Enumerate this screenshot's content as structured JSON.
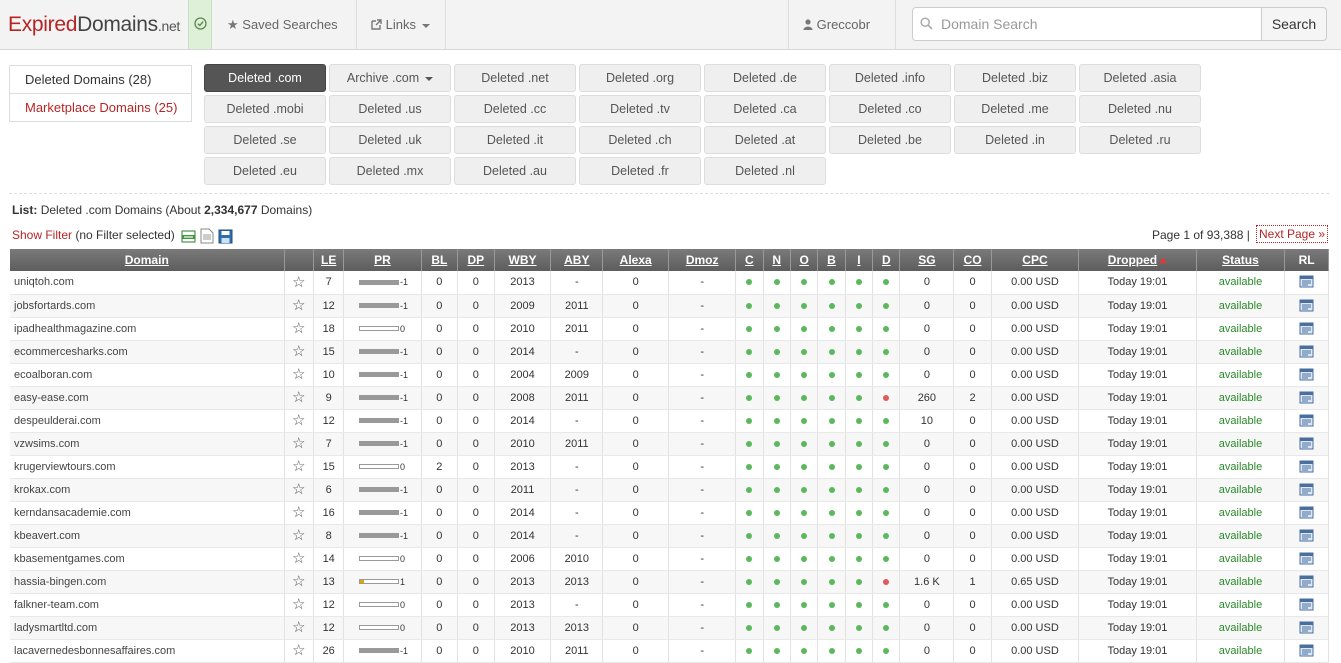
{
  "brand": {
    "part1": "Expired",
    "part2": "Domains",
    "part3": ".net"
  },
  "nav": {
    "saved_searches": "Saved Searches",
    "links": "Links",
    "user": "Greccobr",
    "search_placeholder": "Domain Search",
    "search_button": "Search"
  },
  "sidebar": {
    "items": [
      {
        "label": "Deleted Domains (28)"
      },
      {
        "label": "Marketplace Domains (25)"
      }
    ]
  },
  "tlds": [
    [
      "Deleted .com",
      "Archive .com",
      "Deleted .net",
      "Deleted .org",
      "Deleted .de",
      "Deleted .info",
      "Deleted .biz",
      "Deleted .asia"
    ],
    [
      "Deleted .mobi",
      "Deleted .us",
      "Deleted .cc",
      "Deleted .tv",
      "Deleted .ca",
      "Deleted .co",
      "Deleted .me",
      "Deleted .nu"
    ],
    [
      "Deleted .se",
      "Deleted .uk",
      "Deleted .it",
      "Deleted .ch",
      "Deleted .at",
      "Deleted .be",
      "Deleted .in",
      "Deleted .ru"
    ],
    [
      "Deleted .eu",
      "Deleted .mx",
      "Deleted .au",
      "Deleted .fr",
      "Deleted .nl"
    ]
  ],
  "list": {
    "label": "List:",
    "text": "Deleted .com Domains (About",
    "count": "2,334,677",
    "suffix": "Domains)"
  },
  "filter": {
    "link": "Show Filter",
    "state": "(no Filter selected)"
  },
  "pagination": {
    "info": "Page 1 of 93,388",
    "separator": "|",
    "next": "Next Page »"
  },
  "table": {
    "headers": [
      "Domain",
      "",
      "LE",
      "PR",
      "BL",
      "DP",
      "WBY",
      "ABY",
      "Alexa",
      "Dmoz",
      "C",
      "N",
      "O",
      "B",
      "I",
      "D",
      "SG",
      "CO",
      "CPC",
      "Dropped",
      "Status",
      "RL"
    ],
    "rows": [
      {
        "domain": "uniqtoh.com",
        "le": "7",
        "pr": "-1",
        "bl": "0",
        "dp": "0",
        "wby": "2013",
        "aby": "-",
        "alexa": "0",
        "dmoz": "-",
        "d": "green",
        "sg": "0",
        "co": "0",
        "cpc": "0.00 USD",
        "dropped": "Today 19:01",
        "status": "available"
      },
      {
        "domain": "jobsfortards.com",
        "le": "12",
        "pr": "-1",
        "bl": "0",
        "dp": "0",
        "wby": "2009",
        "aby": "2011",
        "alexa": "0",
        "dmoz": "-",
        "d": "green",
        "sg": "0",
        "co": "0",
        "cpc": "0.00 USD",
        "dropped": "Today 19:01",
        "status": "available"
      },
      {
        "domain": "ipadhealthmagazine.com",
        "le": "18",
        "pr": "0",
        "bl": "0",
        "dp": "0",
        "wby": "2010",
        "aby": "2011",
        "alexa": "0",
        "dmoz": "-",
        "d": "green",
        "sg": "0",
        "co": "0",
        "cpc": "0.00 USD",
        "dropped": "Today 19:01",
        "status": "available"
      },
      {
        "domain": "ecommercesharks.com",
        "le": "15",
        "pr": "-1",
        "bl": "0",
        "dp": "0",
        "wby": "2014",
        "aby": "-",
        "alexa": "0",
        "dmoz": "-",
        "d": "green",
        "sg": "0",
        "co": "0",
        "cpc": "0.00 USD",
        "dropped": "Today 19:01",
        "status": "available"
      },
      {
        "domain": "ecoalboran.com",
        "le": "10",
        "pr": "-1",
        "bl": "0",
        "dp": "0",
        "wby": "2004",
        "aby": "2009",
        "alexa": "0",
        "dmoz": "-",
        "d": "green",
        "sg": "0",
        "co": "0",
        "cpc": "0.00 USD",
        "dropped": "Today 19:01",
        "status": "available"
      },
      {
        "domain": "easy-ease.com",
        "le": "9",
        "pr": "-1",
        "bl": "0",
        "dp": "0",
        "wby": "2008",
        "aby": "2011",
        "alexa": "0",
        "dmoz": "-",
        "d": "red",
        "sg": "260",
        "co": "2",
        "cpc": "0.00 USD",
        "dropped": "Today 19:01",
        "status": "available"
      },
      {
        "domain": "despeulderai.com",
        "le": "12",
        "pr": "-1",
        "bl": "0",
        "dp": "0",
        "wby": "2014",
        "aby": "-",
        "alexa": "0",
        "dmoz": "-",
        "d": "green",
        "sg": "10",
        "co": "0",
        "cpc": "0.00 USD",
        "dropped": "Today 19:01",
        "status": "available"
      },
      {
        "domain": "vzwsims.com",
        "le": "7",
        "pr": "-1",
        "bl": "0",
        "dp": "0",
        "wby": "2010",
        "aby": "2011",
        "alexa": "0",
        "dmoz": "-",
        "d": "green",
        "sg": "0",
        "co": "0",
        "cpc": "0.00 USD",
        "dropped": "Today 19:01",
        "status": "available"
      },
      {
        "domain": "krugerviewtours.com",
        "le": "15",
        "pr": "0",
        "bl": "2",
        "dp": "0",
        "wby": "2013",
        "aby": "-",
        "alexa": "0",
        "dmoz": "-",
        "d": "green",
        "sg": "0",
        "co": "0",
        "cpc": "0.00 USD",
        "dropped": "Today 19:01",
        "status": "available"
      },
      {
        "domain": "krokax.com",
        "le": "6",
        "pr": "-1",
        "bl": "0",
        "dp": "0",
        "wby": "2011",
        "aby": "-",
        "alexa": "0",
        "dmoz": "-",
        "d": "green",
        "sg": "0",
        "co": "0",
        "cpc": "0.00 USD",
        "dropped": "Today 19:01",
        "status": "available"
      },
      {
        "domain": "kerndansacademie.com",
        "le": "16",
        "pr": "-1",
        "bl": "0",
        "dp": "0",
        "wby": "2014",
        "aby": "-",
        "alexa": "0",
        "dmoz": "-",
        "d": "green",
        "sg": "0",
        "co": "0",
        "cpc": "0.00 USD",
        "dropped": "Today 19:01",
        "status": "available"
      },
      {
        "domain": "kbeavert.com",
        "le": "8",
        "pr": "-1",
        "bl": "0",
        "dp": "0",
        "wby": "2014",
        "aby": "-",
        "alexa": "0",
        "dmoz": "-",
        "d": "green",
        "sg": "0",
        "co": "0",
        "cpc": "0.00 USD",
        "dropped": "Today 19:01",
        "status": "available"
      },
      {
        "domain": "kbasementgames.com",
        "le": "14",
        "pr": "0",
        "bl": "0",
        "dp": "0",
        "wby": "2006",
        "aby": "2010",
        "alexa": "0",
        "dmoz": "-",
        "d": "green",
        "sg": "0",
        "co": "0",
        "cpc": "0.00 USD",
        "dropped": "Today 19:01",
        "status": "available"
      },
      {
        "domain": "hassia-bingen.com",
        "le": "13",
        "pr": "1",
        "bl": "0",
        "dp": "0",
        "wby": "2013",
        "aby": "2013",
        "alexa": "0",
        "dmoz": "-",
        "d": "red",
        "sg": "1.6 K",
        "co": "1",
        "cpc": "0.65 USD",
        "dropped": "Today 19:01",
        "status": "available"
      },
      {
        "domain": "falkner-team.com",
        "le": "12",
        "pr": "0",
        "bl": "0",
        "dp": "0",
        "wby": "2013",
        "aby": "-",
        "alexa": "0",
        "dmoz": "-",
        "d": "green",
        "sg": "0",
        "co": "0",
        "cpc": "0.00 USD",
        "dropped": "Today 19:01",
        "status": "available"
      },
      {
        "domain": "ladysmartltd.com",
        "le": "12",
        "pr": "0",
        "bl": "0",
        "dp": "0",
        "wby": "2013",
        "aby": "2013",
        "alexa": "0",
        "dmoz": "-",
        "d": "green",
        "sg": "0",
        "co": "0",
        "cpc": "0.00 USD",
        "dropped": "Today 19:01",
        "status": "available"
      },
      {
        "domain": "lacavernedesbonnesaffaires.com",
        "le": "26",
        "pr": "-1",
        "bl": "0",
        "dp": "0",
        "wby": "2010",
        "aby": "2011",
        "alexa": "0",
        "dmoz": "-",
        "d": "green",
        "sg": "0",
        "co": "0",
        "cpc": "0.00 USD",
        "dropped": "Today 19:01",
        "status": "available"
      }
    ]
  },
  "colors": {
    "brand_red": "#b52525",
    "status_green": "#2a8a2a",
    "dot_green": "#5cb85c",
    "dot_red": "#e05a5a",
    "pr_bar": "#999999",
    "pr_bar_positive": "#e0a800"
  }
}
